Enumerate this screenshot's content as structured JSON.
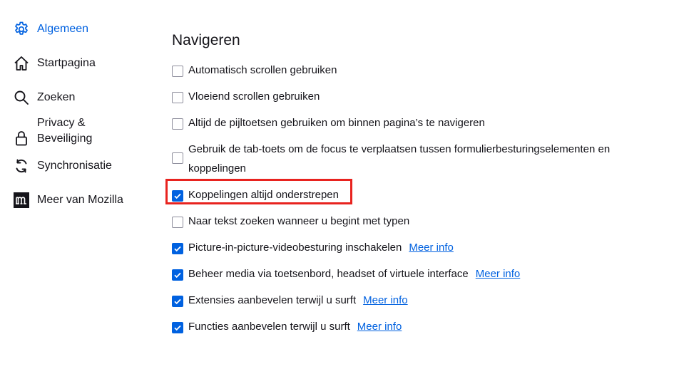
{
  "sidebar": {
    "items": [
      {
        "label": "Algemeen",
        "icon": "gear-icon",
        "active": true
      },
      {
        "label": "Startpagina",
        "icon": "home-icon",
        "active": false
      },
      {
        "label": "Zoeken",
        "icon": "search-icon",
        "active": false
      },
      {
        "label": "Privacy & Beveiliging",
        "icon": "lock-icon",
        "active": false
      },
      {
        "label": "Synchronisatie",
        "icon": "sync-icon",
        "active": false
      },
      {
        "label": "Meer van Mozilla",
        "icon": "mozilla-icon",
        "active": false
      }
    ]
  },
  "main": {
    "section_title": "Navigeren",
    "options": [
      {
        "label": "Automatisch scrollen gebruiken",
        "checked": false
      },
      {
        "label": "Vloeiend scrollen gebruiken",
        "checked": false
      },
      {
        "label": "Altijd de pijltoetsen gebruiken om binnen pagina’s te navigeren",
        "checked": false
      },
      {
        "label": "Gebruik de tab-toets om de focus te verplaatsen tussen formulierbesturingselementen en koppelingen",
        "checked": false
      },
      {
        "label": "Koppelingen altijd onderstrepen",
        "checked": true
      },
      {
        "label": "Naar tekst zoeken wanneer u begint met typen",
        "checked": false
      },
      {
        "label": "Picture-in-picture-videobesturing inschakelen",
        "checked": true,
        "link": "Meer info"
      },
      {
        "label": "Beheer media via toetsenbord, headset of virtuele interface",
        "checked": true,
        "link": "Meer info"
      },
      {
        "label": "Extensies aanbevelen terwijl u surft",
        "checked": true,
        "link": "Meer info"
      },
      {
        "label": "Functies aanbevelen terwijl u surft",
        "checked": true,
        "link": "Meer info"
      }
    ]
  },
  "colors": {
    "accent": "#0061e0",
    "highlight": "#e8231f",
    "text": "#15141a"
  }
}
